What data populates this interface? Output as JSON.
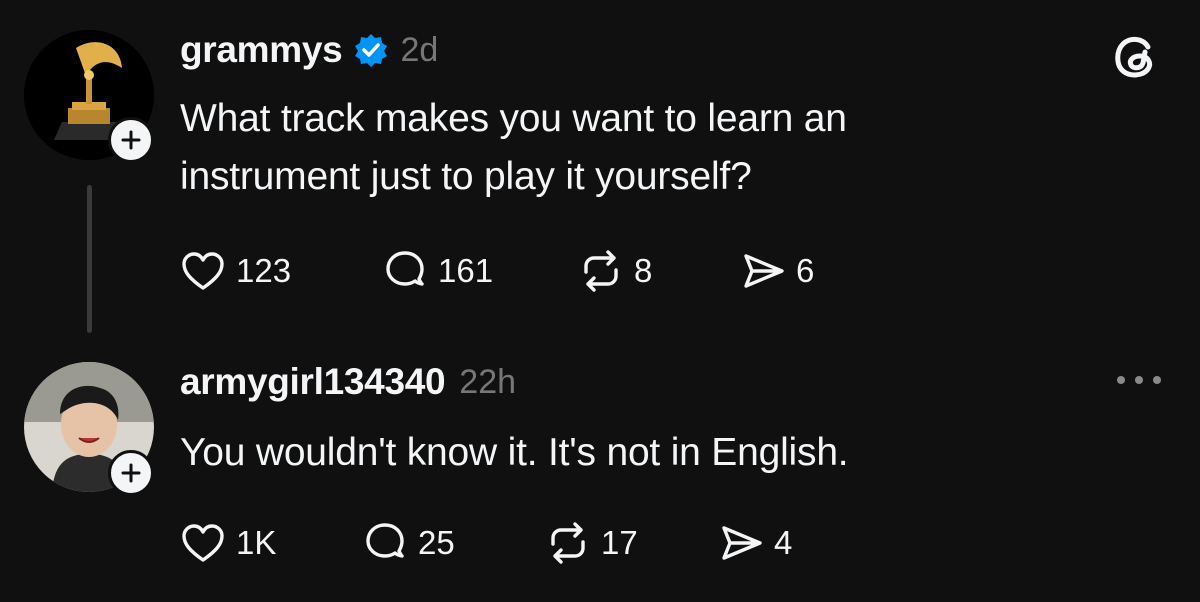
{
  "app": {
    "logo_icon": "threads-logo-icon"
  },
  "posts": [
    {
      "username": "grammys",
      "verified": true,
      "time": "2d",
      "text_lines": [
        "What track makes you want to learn an",
        "instrument just to play it yourself?"
      ],
      "actions": {
        "likes": "123",
        "replies": "161",
        "reposts": "8",
        "shares": "6"
      }
    },
    {
      "username": "armygirl134340",
      "verified": false,
      "time": "22h",
      "text_lines": [
        "You wouldn't know it. It's not in English."
      ],
      "actions": {
        "likes": "1K",
        "replies": "25",
        "reposts": "17",
        "shares": "4"
      }
    }
  ],
  "colors": {
    "background": "#101010",
    "text": "#f3f5f7",
    "muted": "#777777",
    "verified": "#0095f6",
    "thread_line": "#3a3a3a"
  }
}
